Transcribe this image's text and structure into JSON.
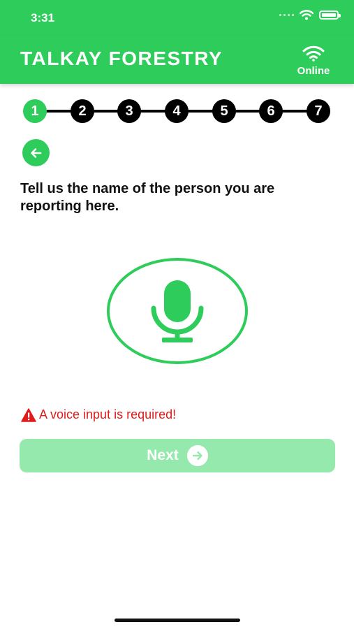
{
  "status_bar": {
    "time": "3:31"
  },
  "header": {
    "title": "TALKAY FORESTRY",
    "status": "Online",
    "status_icon": "wifi-icon"
  },
  "stepper": {
    "steps": [
      "1",
      "2",
      "3",
      "4",
      "5",
      "6",
      "7"
    ],
    "current": 1
  },
  "back": {
    "icon": "arrow-left-icon"
  },
  "question": "Tell us the name of the person you are reporting here.",
  "mic": {
    "icon": "microphone-icon"
  },
  "error": {
    "text": "A voice input is required!",
    "icon": "warning-icon"
  },
  "next_button": {
    "label": "Next",
    "icon": "arrow-right-icon"
  },
  "colors": {
    "brand": "#2ecc5a",
    "error": "#e11b1b",
    "disabled_button": "#95e9ad"
  }
}
